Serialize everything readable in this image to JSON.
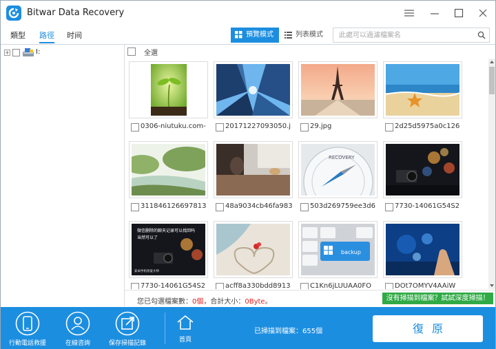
{
  "window": {
    "title": "Bitwar Data Recovery"
  },
  "toolbar": {
    "tabs": [
      "類型",
      "路徑",
      "时间"
    ],
    "view_preview": "預覽模式",
    "view_list": "列表模式",
    "search_placeholder": "此處可以過濾檔案名"
  },
  "tree": {
    "drive_label": "I:"
  },
  "grid": {
    "select_all": "全選",
    "files": [
      {
        "name": "0306-niutuku.com-",
        "thumb": "sprout"
      },
      {
        "name": "20171227093050.j",
        "thumb": "skyscrapers"
      },
      {
        "name": "29.jpg",
        "thumb": "eiffel"
      },
      {
        "name": "2d25d5975a0c126",
        "thumb": "starfish"
      },
      {
        "name": "311846126697813",
        "thumb": "river"
      },
      {
        "name": "48a9034cb46fa983",
        "thumb": "cafe"
      },
      {
        "name": "503d269759ee3d6",
        "thumb": "compass"
      },
      {
        "name": "7730-14061G54S2",
        "thumb": "camera-bokeh"
      },
      {
        "name": "7730-14061G54S2",
        "thumb": "camera-text"
      },
      {
        "name": "acff8a330bdd8913",
        "thumb": "heart-sand"
      },
      {
        "name": "C1Kn6jLUUAA0FO",
        "thumb": "keyboard"
      },
      {
        "name": "DOt7OMYV4AAiW",
        "thumb": "touch-screen"
      }
    ],
    "overlay_text": {
      "camera_text_line1": "微信删除的聊天记录可以找回吗",
      "camera_text_line2": "当然可以了",
      "camera_text_line3": "安卓手机恢复大师",
      "compass_label": "RECOVERY",
      "backup_label": "backup"
    }
  },
  "status": {
    "selected_prefix": "您已勾選檔案數：",
    "selected_count": "0個",
    "size_prefix": "，合計大小：",
    "size_value": "0Byte",
    "size_suffix": "。",
    "deep_scan": "沒有掃描到檔案？試試深度掃描！"
  },
  "bottombar": {
    "mobile_recovery": "行動電話救援",
    "online_consult": "在線咨詢",
    "save_scan": "保存掃描記錄",
    "home": "首頁",
    "scanned_text": "已掃描到檔案：655個",
    "restore": "復原"
  },
  "colors": {
    "brand": "#1c8ee0",
    "deep_scan": "#2faa45",
    "highlight": "#e02020"
  }
}
